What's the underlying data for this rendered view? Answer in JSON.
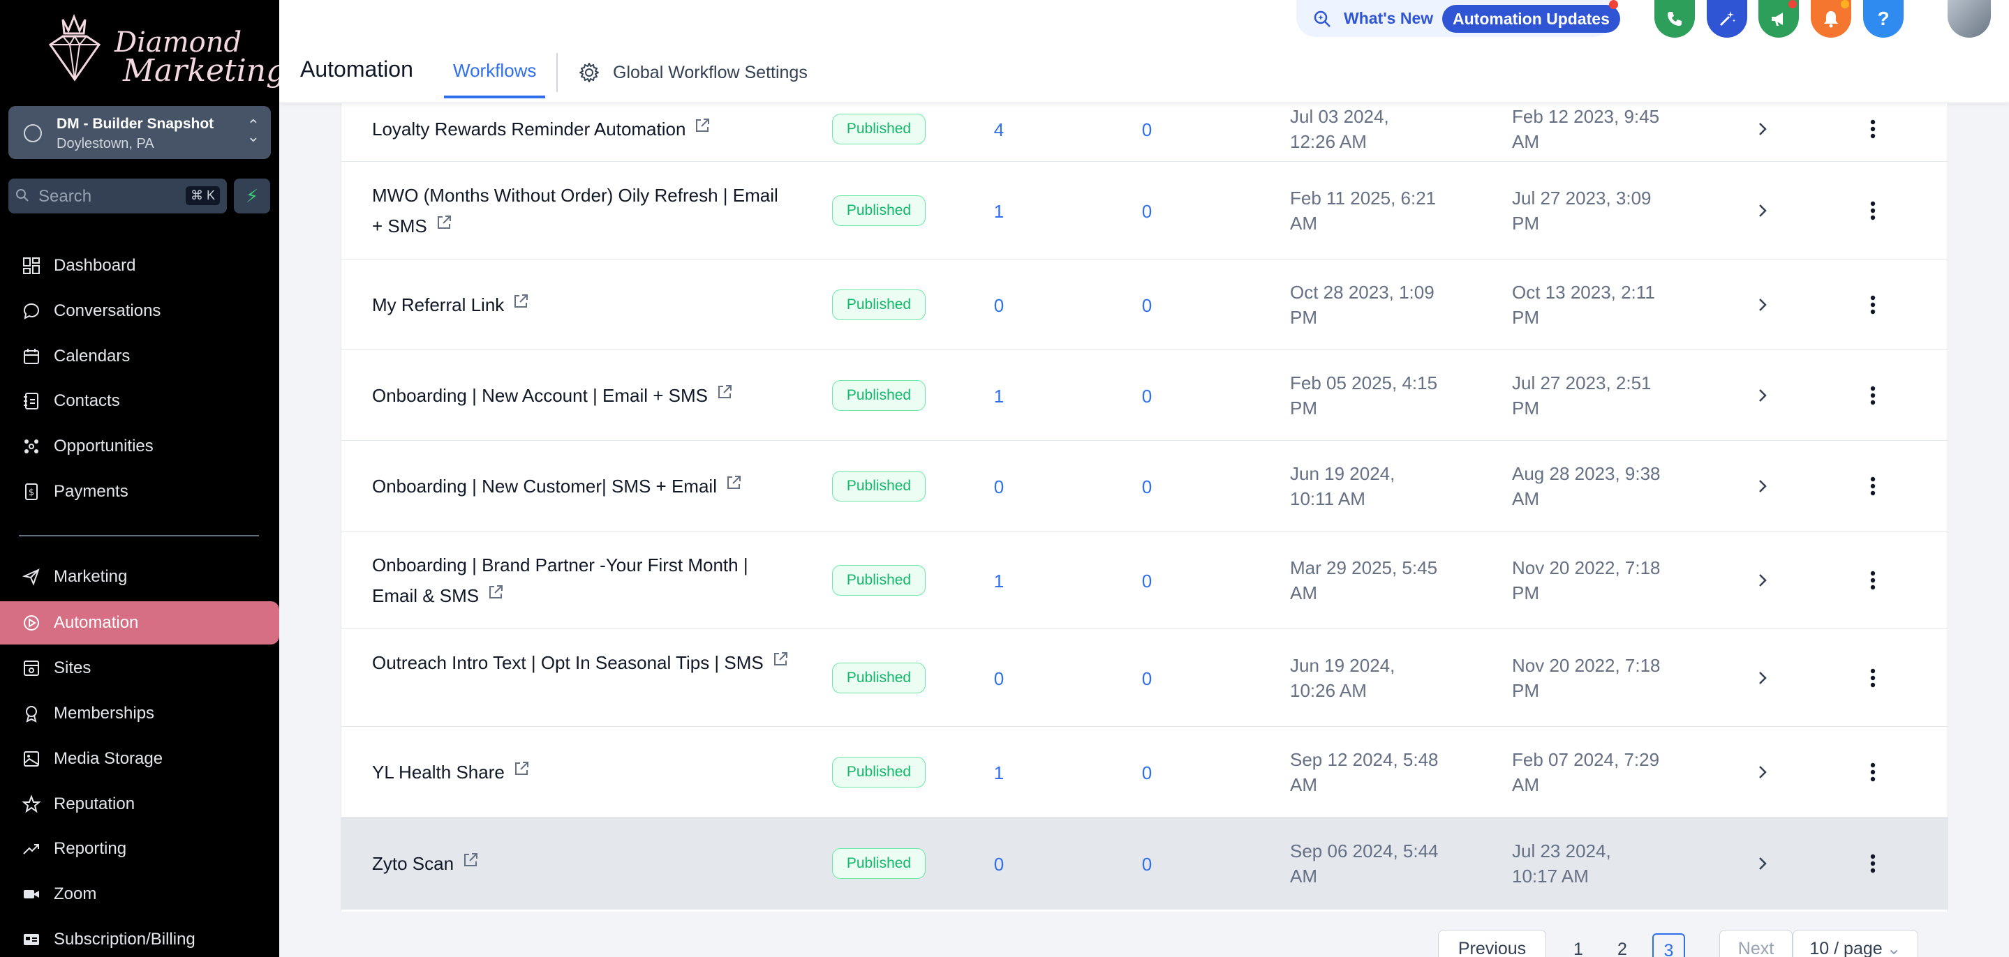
{
  "brand": {
    "line1": "Diamond",
    "line2": "Marketing"
  },
  "account": {
    "name": "DM - Builder Snapshot",
    "location": "Doylestown, PA"
  },
  "search": {
    "placeholder": "Search",
    "shortcut": "⌘ K"
  },
  "sidebar": {
    "items": [
      {
        "label": "Dashboard",
        "icon": "dashboard-icon"
      },
      {
        "label": "Conversations",
        "icon": "chat-icon"
      },
      {
        "label": "Calendars",
        "icon": "calendar-icon"
      },
      {
        "label": "Contacts",
        "icon": "contacts-icon"
      },
      {
        "label": "Opportunities",
        "icon": "opportunities-icon"
      },
      {
        "label": "Payments",
        "icon": "payments-icon"
      },
      {
        "label": "Marketing",
        "icon": "send-icon"
      },
      {
        "label": "Automation",
        "icon": "automation-icon",
        "active": true
      },
      {
        "label": "Sites",
        "icon": "sites-icon"
      },
      {
        "label": "Memberships",
        "icon": "memberships-icon"
      },
      {
        "label": "Media Storage",
        "icon": "image-icon"
      },
      {
        "label": "Reputation",
        "icon": "star-icon"
      },
      {
        "label": "Reporting",
        "icon": "trend-icon"
      },
      {
        "label": "Zoom",
        "icon": "video-icon"
      },
      {
        "label": "Subscription/Billing",
        "icon": "billing-icon"
      }
    ]
  },
  "header": {
    "title": "Automation",
    "tabs": {
      "workflows": "Workflows",
      "global": "Global Workflow Settings"
    },
    "whats_new": "What's New",
    "automation_updates": "Automation Updates"
  },
  "table": {
    "rows": [
      {
        "name": "Loyalty Rewards Reminder Automation",
        "status": "Published",
        "count1": "4",
        "count2": "0",
        "date1": [
          "Jul 03 2024,",
          "12:26 AM"
        ],
        "date2": [
          "Feb 12 2023, 9:45",
          "AM"
        ]
      },
      {
        "name": "MWO (Months Without Order) Oily Refresh | Email + SMS",
        "status": "Published",
        "count1": "1",
        "count2": "0",
        "date1": [
          "Feb 11 2025, 6:21",
          "AM"
        ],
        "date2": [
          "Jul 27 2023, 3:09",
          "PM"
        ]
      },
      {
        "name": "My Referral Link",
        "status": "Published",
        "count1": "0",
        "count2": "0",
        "date1": [
          "Oct 28 2023, 1:09",
          "PM"
        ],
        "date2": [
          "Oct 13 2023, 2:11",
          "PM"
        ]
      },
      {
        "name": "Onboarding | New Account | Email + SMS",
        "status": "Published",
        "count1": "1",
        "count2": "0",
        "date1": [
          "Feb 05 2025, 4:15",
          "PM"
        ],
        "date2": [
          "Jul 27 2023, 2:51",
          "PM"
        ]
      },
      {
        "name": "Onboarding | New Customer| SMS + Email",
        "status": "Published",
        "count1": "0",
        "count2": "0",
        "date1": [
          "Jun 19 2024,",
          "10:11 AM"
        ],
        "date2": [
          "Aug 28 2023, 9:38",
          "AM"
        ]
      },
      {
        "name": "Onboarding  | Brand Partner -Your First Month | Email & SMS",
        "status": "Published",
        "count1": "1",
        "count2": "0",
        "date1": [
          "Mar 29 2025, 5:45",
          "AM"
        ],
        "date2": [
          "Nov 20 2022, 7:18",
          "PM"
        ]
      },
      {
        "name": "Outreach Intro Text | Opt In Seasonal Tips | SMS",
        "status": "Published",
        "count1": "0",
        "count2": "0",
        "date1": [
          "Jun 19 2024,",
          "10:26 AM"
        ],
        "date2": [
          "Nov 20 2022, 7:18",
          "PM"
        ]
      },
      {
        "name": "YL Health Share",
        "status": "Published",
        "count1": "1",
        "count2": "0",
        "date1": [
          "Sep 12 2024, 5:48",
          "AM"
        ],
        "date2": [
          "Feb 07 2024, 7:29",
          "AM"
        ]
      },
      {
        "name": "Zyto Scan",
        "status": "Published",
        "count1": "0",
        "count2": "0",
        "date1": [
          "Sep 06 2024, 5:44",
          "AM"
        ],
        "date2": [
          "Jul 23 2024,",
          "10:17 AM"
        ]
      }
    ]
  },
  "pagination": {
    "previous": "Previous",
    "pages": [
      "1",
      "2",
      "3"
    ],
    "current": "3",
    "next": "Next",
    "per_page": "10 / page"
  },
  "colors": {
    "accent": "#2f6fed",
    "active_nav": "#d66f83",
    "published": "#12b76a"
  }
}
